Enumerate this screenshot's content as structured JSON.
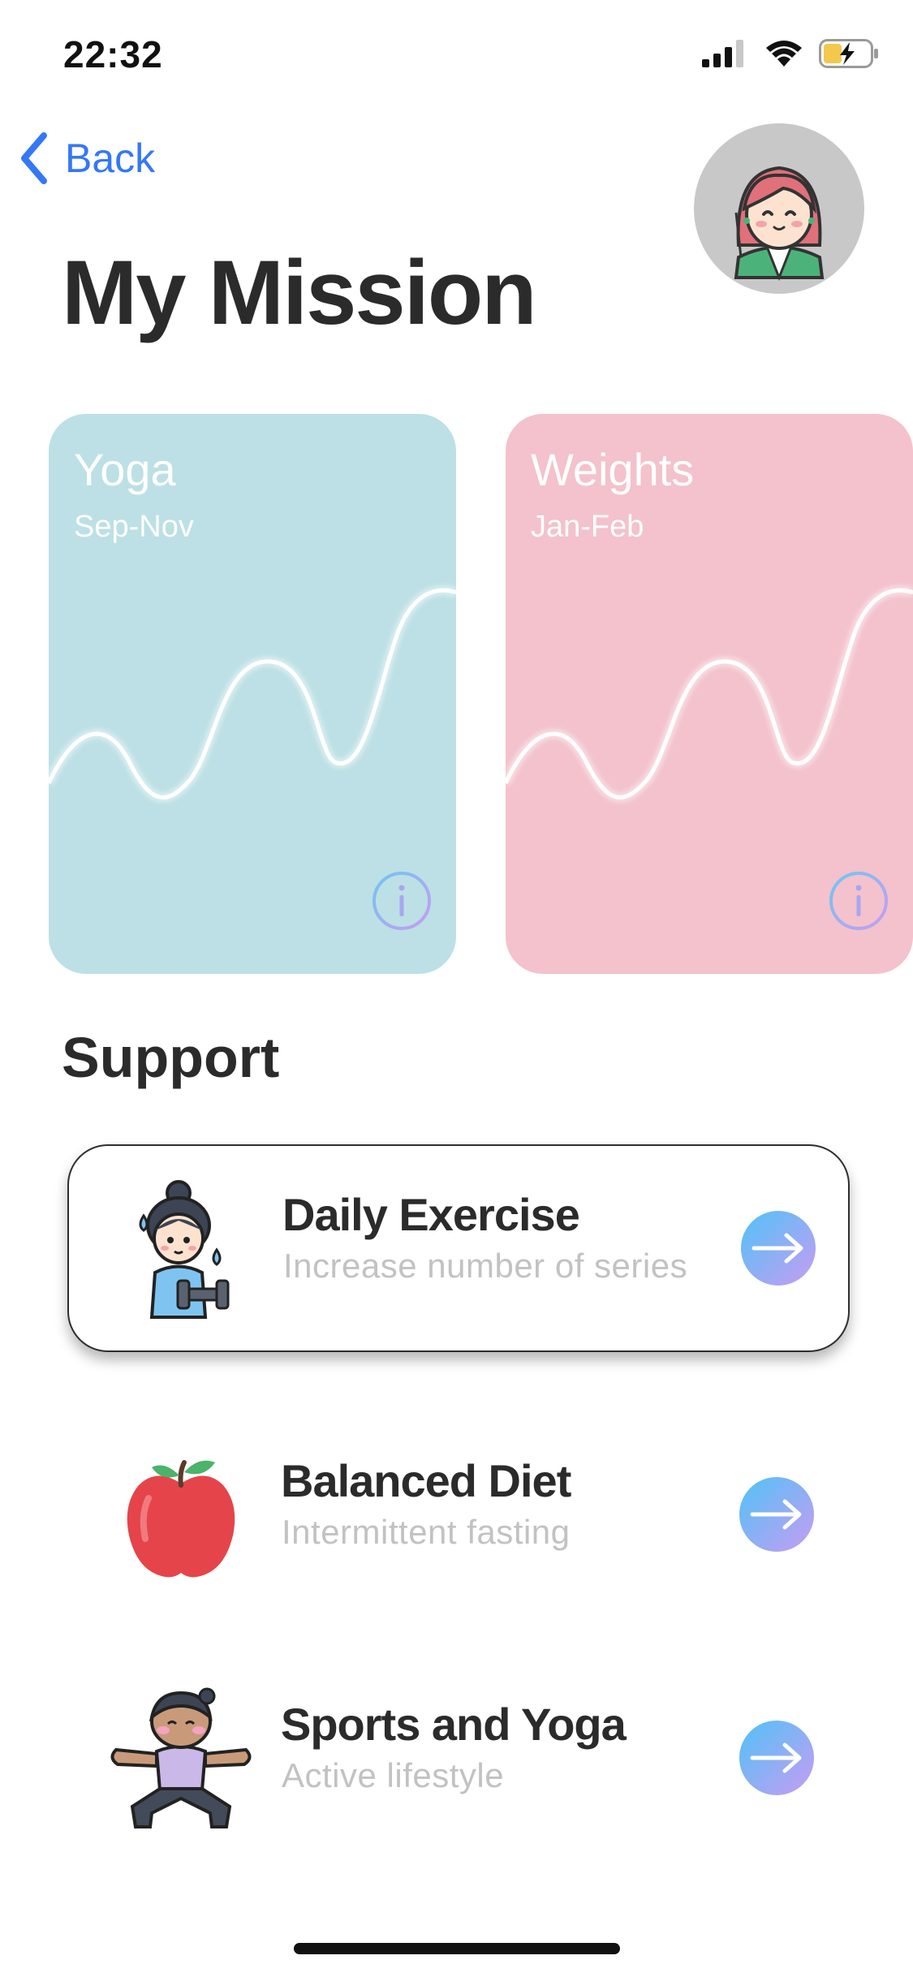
{
  "status_bar": {
    "time": "22:32",
    "icons": [
      "signal-icon",
      "wifi-icon",
      "battery-charging-icon"
    ]
  },
  "nav": {
    "back_label": "Back"
  },
  "title": "My Mission",
  "missions": [
    {
      "name": "Yoga",
      "period": "Sep-Nov",
      "color": "#bce0e5",
      "icon": "info-icon"
    },
    {
      "name": "Weights",
      "period": "Jan-Feb",
      "color": "#f3c2cc",
      "icon": "info-icon"
    }
  ],
  "support": {
    "title": "Support",
    "items": [
      {
        "title": "Daily Exercise",
        "subtitle": "Increase number of series",
        "icon": "exercise-girl-icon",
        "selected": true
      },
      {
        "title": "Balanced Diet",
        "subtitle": "Intermittent fasting",
        "icon": "apple-icon",
        "selected": false
      },
      {
        "title": "Sports and Yoga",
        "subtitle": "Active lifestyle",
        "icon": "yoga-pose-icon",
        "selected": false
      }
    ]
  },
  "colors": {
    "accent_blue": "#3478f6",
    "arrow_gradient_start": "#4fc3f7",
    "arrow_gradient_end": "#c89cf2"
  }
}
